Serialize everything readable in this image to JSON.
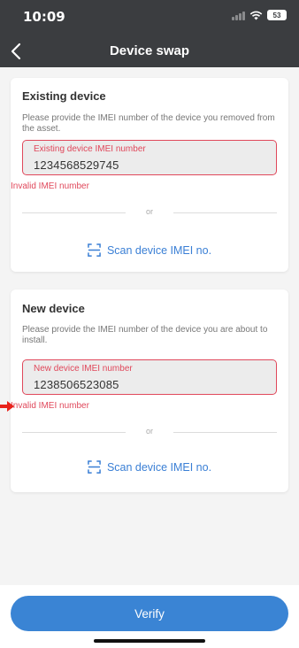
{
  "status_bar": {
    "time": "10:09",
    "battery": "53"
  },
  "nav": {
    "title": "Device swap"
  },
  "existing": {
    "title": "Existing device",
    "description": "Please provide the IMEI number of the device you removed from the asset.",
    "field_label": "Existing device IMEI number",
    "field_value": "1234568529745",
    "error": "Invalid IMEI number",
    "divider_text": "or",
    "scan_label": "Scan device IMEI no."
  },
  "new_device": {
    "title": "New device",
    "description": "Please provide the IMEI number of the device you are about to install.",
    "field_label": "New device IMEI number",
    "field_value": "1238506523085",
    "error": "Invalid IMEI number",
    "divider_text": "or",
    "scan_label": "Scan device IMEI no."
  },
  "footer": {
    "verify_label": "Verify"
  },
  "colors": {
    "header": "#3b3d40",
    "error": "#e0485b",
    "accent": "#3a84d4",
    "annotation_arrow": "#e8231b"
  }
}
